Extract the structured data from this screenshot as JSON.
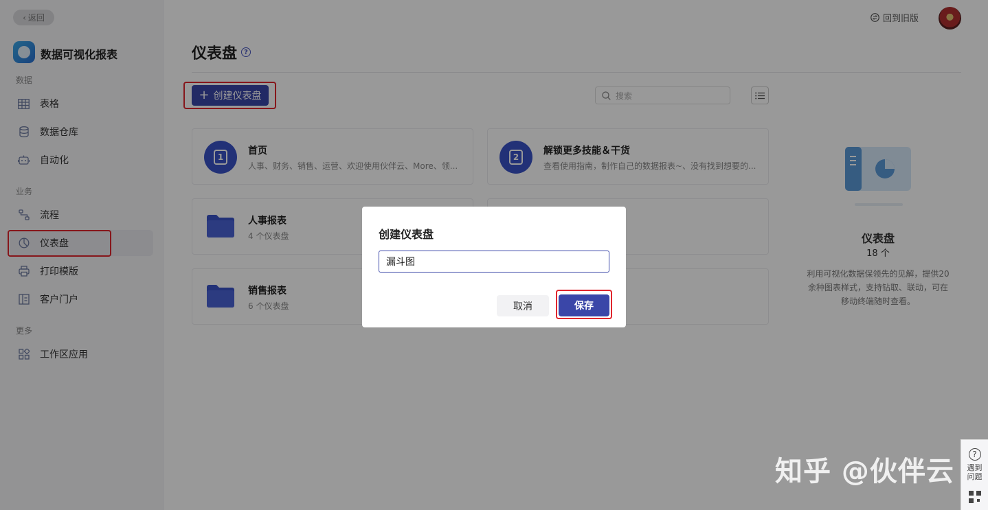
{
  "sidebar": {
    "back_label": "返回",
    "app_title": "数据可视化报表",
    "sections": [
      {
        "label": "数据"
      },
      {
        "label": "业务"
      },
      {
        "label": "更多"
      }
    ],
    "items": [
      {
        "label": "表格",
        "icon": "table-icon"
      },
      {
        "label": "数据仓库",
        "icon": "database-icon"
      },
      {
        "label": "自动化",
        "icon": "robot-icon"
      },
      {
        "label": "流程",
        "icon": "flow-icon"
      },
      {
        "label": "仪表盘",
        "icon": "dashboard-icon",
        "active": true
      },
      {
        "label": "打印模版",
        "icon": "printer-icon"
      },
      {
        "label": "客户门户",
        "icon": "portal-icon"
      },
      {
        "label": "工作区应用",
        "icon": "apps-icon"
      }
    ]
  },
  "header": {
    "old_version_label": "回到旧版"
  },
  "main": {
    "title": "仪表盘",
    "create_button": "创建仪表盘",
    "search_placeholder": "搜索",
    "cards": [
      {
        "title": "首页",
        "subtitle": "人事、财务、销售、运营、欢迎使用伙伴云、More、领...",
        "badge": "1"
      },
      {
        "title": "解锁更多技能＆干货",
        "subtitle": "查看使用指南，制作自己的数据报表~、没有找到想要的...",
        "badge": "2"
      },
      {
        "title": "人事报表",
        "subtitle": "4 个仪表盘"
      },
      {
        "title": "销售报表",
        "subtitle": "6 个仪表盘"
      }
    ]
  },
  "info_panel": {
    "title": "仪表盘",
    "count": "18 个",
    "description": "利用可视化数据保领先的见解，提供20余种图表样式，支持钻取、联动，可在移动终端随时查看。"
  },
  "dialog": {
    "title": "创建仪表盘",
    "input_value": "漏斗图",
    "cancel_label": "取消",
    "save_label": "保存"
  },
  "help_float": {
    "label_line1": "遇到",
    "label_line2": "问题"
  },
  "watermark": "知乎 @伙伴云",
  "colors": {
    "primary": "#3a46a8",
    "highlight": "#e0262d"
  }
}
